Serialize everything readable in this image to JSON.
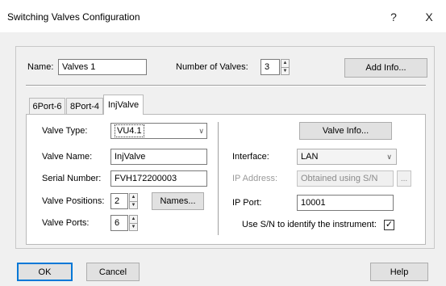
{
  "window": {
    "title": "Switching Valves Configuration",
    "help_glyph": "?",
    "close_glyph": "X"
  },
  "top": {
    "name_label": "Name:",
    "name_value": "Valves 1",
    "num_valves_label": "Number of Valves:",
    "num_valves_value": "3",
    "add_info_label": "Add Info..."
  },
  "tabs": [
    {
      "label": "6Port-6"
    },
    {
      "label": "8Port-4"
    },
    {
      "label": "InjValve",
      "active": true
    }
  ],
  "valve": {
    "type_label": "Valve Type:",
    "type_value": "VU4.1",
    "name_label": "Valve Name:",
    "name_value": "InjValve",
    "serial_label": "Serial Number:",
    "serial_value": "FVH172200003",
    "positions_label": "Valve Positions:",
    "positions_value": "2",
    "names_button_label": "Names...",
    "ports_label": "Valve Ports:",
    "ports_value": "6",
    "info_button_label": "Valve Info...",
    "interface_label": "Interface:",
    "interface_value": "LAN",
    "ip_address_label": "IP Address:",
    "ip_address_value": "Obtained using S/N",
    "ip_browse_label": "...",
    "ip_port_label": "IP Port:",
    "ip_port_value": "10001",
    "use_sn_label": "Use S/N to identify the instrument:",
    "use_sn_checked": true
  },
  "footer": {
    "ok_label": "OK",
    "cancel_label": "Cancel",
    "help_label": "Help"
  },
  "icons": {
    "dropdown": "chevron-down-icon",
    "spin_up": "spin-up-icon",
    "spin_down": "spin-down-icon",
    "check": "checkmark-icon"
  },
  "colors": {
    "dialog_bg": "#f0f0f0",
    "default_button_border": "#0078d7"
  }
}
